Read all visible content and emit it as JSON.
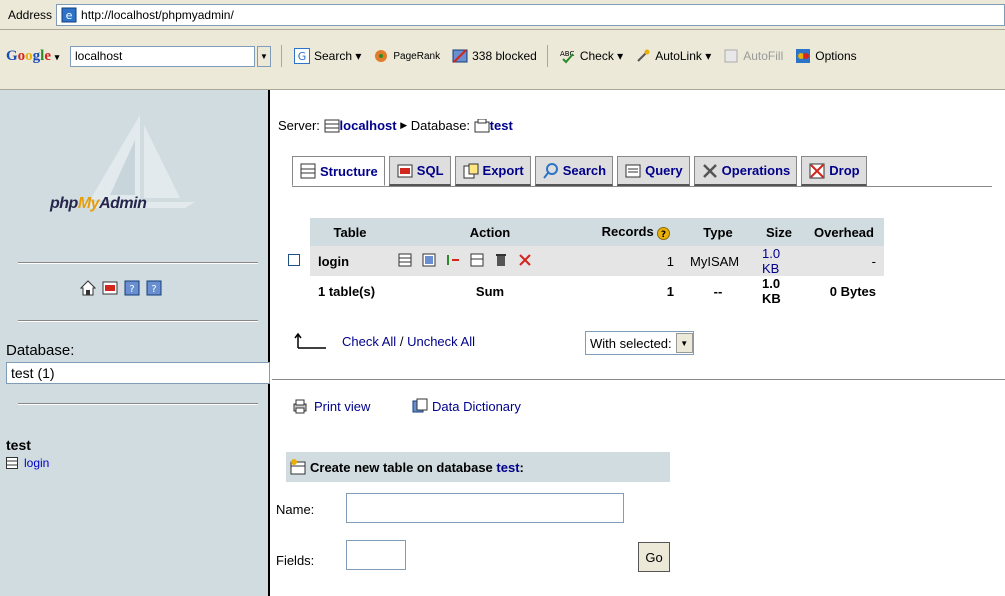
{
  "browser": {
    "address_label": "Address",
    "url": "http://localhost/phpmyadmin/"
  },
  "google_toolbar": {
    "logo": [
      "G",
      "o",
      "o",
      "g",
      "l",
      "e"
    ],
    "search_value": "localhost",
    "search_label": "Search",
    "pagerank_label": "PageRank",
    "blocked_label": "338 blocked",
    "check_label": "Check",
    "autolink_label": "AutoLink",
    "autofill_label": "AutoFill",
    "options_label": "Options"
  },
  "left": {
    "logo_php": "php",
    "logo_my": "My",
    "logo_admin": "Admin",
    "database_label": "Database:",
    "database_value": "test (1)",
    "db_name": "test",
    "tables": [
      "login"
    ]
  },
  "server": {
    "server_label": "Server:",
    "server_name": "localhost",
    "arrow": "▶",
    "database_label": "Database:",
    "database_name": "test"
  },
  "tabs": [
    {
      "label": "Structure"
    },
    {
      "label": "SQL"
    },
    {
      "label": "Export"
    },
    {
      "label": "Search"
    },
    {
      "label": "Query"
    },
    {
      "label": "Operations"
    },
    {
      "label": "Drop"
    }
  ],
  "table": {
    "headers": {
      "table": "Table",
      "action": "Action",
      "records": "Records",
      "type": "Type",
      "size": "Size",
      "overhead": "Overhead"
    },
    "rows": [
      {
        "name": "login",
        "records": "1",
        "type": "MyISAM",
        "size": "1.0 KB",
        "overhead": "-"
      }
    ],
    "summary": {
      "name": "1 table(s)",
      "action": "Sum",
      "records": "1",
      "type": "--",
      "size": "1.0 KB",
      "overhead": "0 Bytes"
    }
  },
  "bulk": {
    "check_all": "Check All",
    "sep": "/",
    "uncheck_all": "Uncheck All",
    "with_selected": "With selected:"
  },
  "links": {
    "print_view": "Print view",
    "data_dictionary": "Data Dictionary"
  },
  "create": {
    "title": "Create new table on database",
    "db": "test",
    "colon": ":",
    "name_label": "Name:",
    "fields_label": "Fields:",
    "go": "Go"
  }
}
